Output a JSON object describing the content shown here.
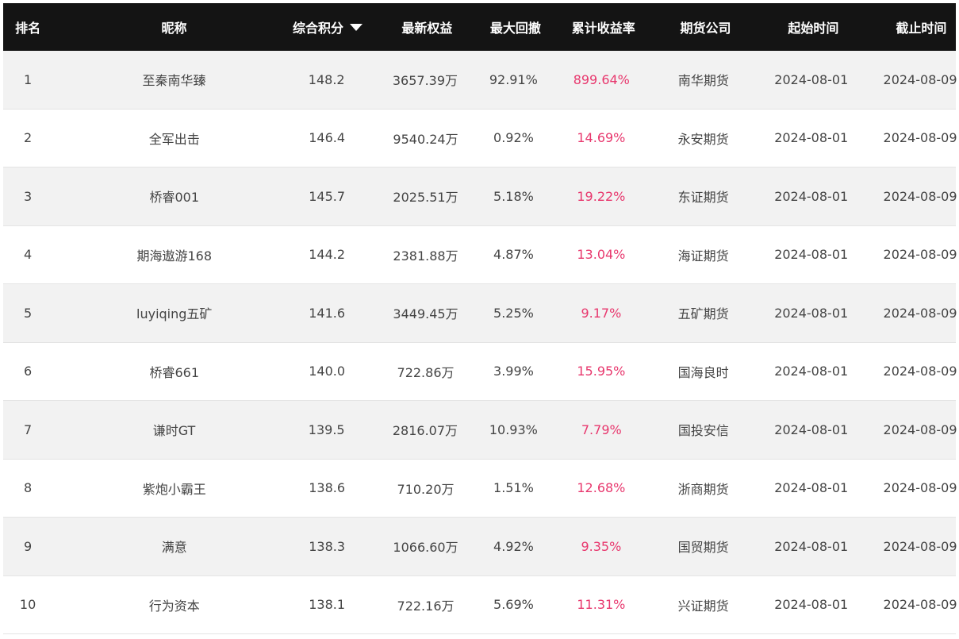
{
  "table": {
    "headers": {
      "rank": "排名",
      "name": "昵称",
      "score": "综合积分",
      "equity": "最新权益",
      "drawdown": "最大回撤",
      "return": "累计收益率",
      "company": "期货公司",
      "start": "起始时间",
      "end": "截止时间"
    },
    "rows": [
      {
        "rank": "1",
        "name": "至秦南华臻",
        "score": "148.2",
        "equity": "3657.39万",
        "drawdown": "92.91%",
        "return": "899.64%",
        "company": "南华期货",
        "start": "2024-08-01",
        "end": "2024-08-09"
      },
      {
        "rank": "2",
        "name": "全军出击",
        "score": "146.4",
        "equity": "9540.24万",
        "drawdown": "0.92%",
        "return": "14.69%",
        "company": "永安期货",
        "start": "2024-08-01",
        "end": "2024-08-09"
      },
      {
        "rank": "3",
        "name": "桥睿001",
        "score": "145.7",
        "equity": "2025.51万",
        "drawdown": "5.18%",
        "return": "19.22%",
        "company": "东证期货",
        "start": "2024-08-01",
        "end": "2024-08-09"
      },
      {
        "rank": "4",
        "name": "期海遨游168",
        "score": "144.2",
        "equity": "2381.88万",
        "drawdown": "4.87%",
        "return": "13.04%",
        "company": "海证期货",
        "start": "2024-08-01",
        "end": "2024-08-09"
      },
      {
        "rank": "5",
        "name": "luyiqing五矿",
        "score": "141.6",
        "equity": "3449.45万",
        "drawdown": "5.25%",
        "return": "9.17%",
        "company": "五矿期货",
        "start": "2024-08-01",
        "end": "2024-08-09"
      },
      {
        "rank": "6",
        "name": "桥睿661",
        "score": "140.0",
        "equity": "722.86万",
        "drawdown": "3.99%",
        "return": "15.95%",
        "company": "国海良时",
        "start": "2024-08-01",
        "end": "2024-08-09"
      },
      {
        "rank": "7",
        "name": "谦时GT",
        "score": "139.5",
        "equity": "2816.07万",
        "drawdown": "10.93%",
        "return": "7.79%",
        "company": "国投安信",
        "start": "2024-08-01",
        "end": "2024-08-09"
      },
      {
        "rank": "8",
        "name": "紫炮小霸王",
        "score": "138.6",
        "equity": "710.20万",
        "drawdown": "1.51%",
        "return": "12.68%",
        "company": "浙商期货",
        "start": "2024-08-01",
        "end": "2024-08-09"
      },
      {
        "rank": "9",
        "name": "满意",
        "score": "138.3",
        "equity": "1066.60万",
        "drawdown": "4.92%",
        "return": "9.35%",
        "company": "国贸期货",
        "start": "2024-08-01",
        "end": "2024-08-09"
      },
      {
        "rank": "10",
        "name": "行为资本",
        "score": "138.1",
        "equity": "722.16万",
        "drawdown": "5.69%",
        "return": "11.31%",
        "company": "兴证期货",
        "start": "2024-08-01",
        "end": "2024-08-09"
      }
    ]
  },
  "colors": {
    "header_bg": "#141414",
    "header_text": "#ffffff",
    "row_alt_bg": "#f2f2f2",
    "return_accent": "#e8386e"
  },
  "icons": {
    "sort": "sort-desc-icon"
  }
}
